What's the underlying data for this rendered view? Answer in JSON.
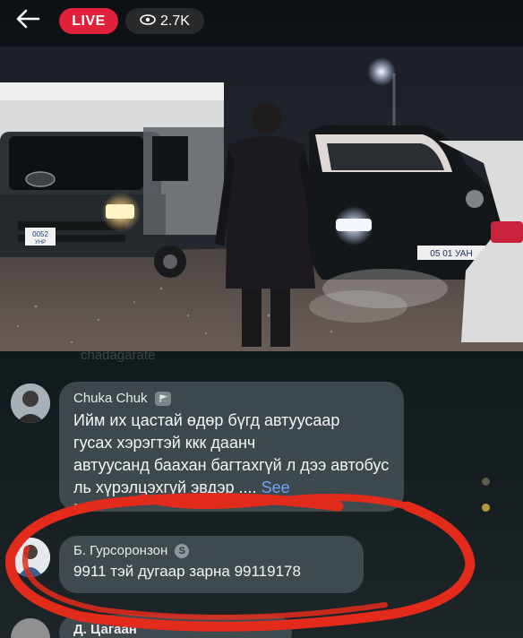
{
  "topbar": {
    "live_label": "LIVE",
    "viewer_count": "2.7K",
    "live_color": "#e1213a"
  },
  "icons": {
    "back": "arrow-left-icon",
    "viewers": "eye-icon",
    "author_badge": "flag-icon",
    "author_badge_2": "badge-icon"
  },
  "faded_caption": "chadagarate",
  "comments": [
    {
      "author": "Chuka Chuk",
      "lines": [
        "Ийм их цастай өдөр бүгд автуусаар",
        "гусах хэрэгтэй ккк даанч",
        "автуусанд баахан багтахгүй л дээ автобус",
        "ль хүрэлцэхгүй эвдэр ...."
      ],
      "see_more": "See",
      "trailing": "M"
    },
    {
      "author": "Б. Гурсоронзон",
      "badge": "S",
      "text": "9911 тэй дугаар зарна 99119178"
    },
    {
      "author_partial": "Д. Цагаан"
    }
  ],
  "video": {
    "plate_left": "0052",
    "plate_left_sub": "УНР",
    "plate_right": "05 01 УАН"
  },
  "colors": {
    "annotation_red": "#e32b1c",
    "see_more": "#6fa3ff"
  }
}
